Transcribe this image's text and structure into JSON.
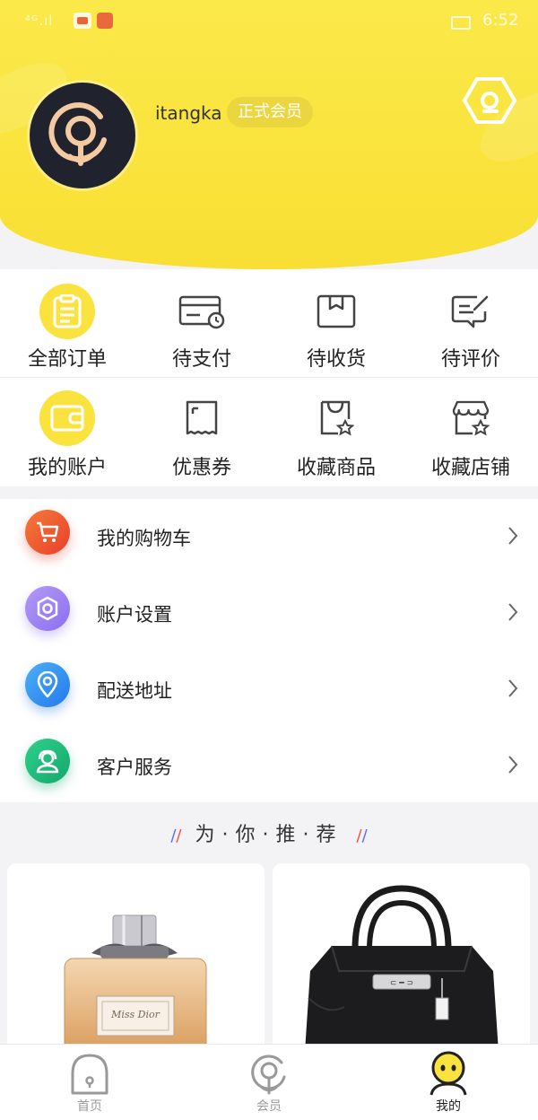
{
  "status_bar": {
    "time": "6:52",
    "signal": "⁴ᴳ.ıl"
  },
  "profile": {
    "username": "itangka",
    "member_badge": "正式会员"
  },
  "orders": [
    {
      "label": "全部订单",
      "icon": "clipboard-icon"
    },
    {
      "label": "待支付",
      "icon": "card-clock-icon"
    },
    {
      "label": "待收货",
      "icon": "box-icon"
    },
    {
      "label": "待评价",
      "icon": "comment-edit-icon"
    }
  ],
  "assets": [
    {
      "label": "我的账户",
      "icon": "wallet-icon"
    },
    {
      "label": "优惠券",
      "icon": "coupon-icon"
    },
    {
      "label": "收藏商品",
      "icon": "bag-star-icon"
    },
    {
      "label": "收藏店铺",
      "icon": "store-star-icon"
    }
  ],
  "menu": [
    {
      "label": "我的购物车",
      "icon": "cart-icon",
      "color": "#f05b2e"
    },
    {
      "label": "账户设置",
      "icon": "gear-icon",
      "color": "#9b7ef2"
    },
    {
      "label": "配送地址",
      "icon": "location-pin-icon",
      "color": "#2f8ff0"
    },
    {
      "label": "客户服务",
      "icon": "headset-icon",
      "color": "#1fb97a"
    }
  ],
  "recommend": {
    "title": "为·你·推·荐"
  },
  "tabs": [
    {
      "label": "首页",
      "icon": "home-arch-icon"
    },
    {
      "label": "会员",
      "icon": "member-pin-icon"
    },
    {
      "label": "我的",
      "icon": "face-icon"
    }
  ],
  "colors": {
    "accent_yellow": "#fbe33f"
  }
}
